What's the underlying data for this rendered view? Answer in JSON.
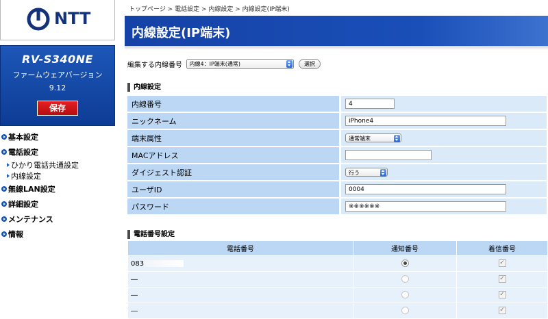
{
  "logo": {
    "brand": "NTT"
  },
  "model": {
    "name": "RV-S340NE",
    "firmware_label": "ファームウェアバージョン",
    "firmware_version": "9.12"
  },
  "save_label": "保存",
  "nav": {
    "basic": "基本設定",
    "phone": "電話設定",
    "phone_sub": [
      "ひかり電話共通設定",
      "内線設定"
    ],
    "wlan": "無線LAN設定",
    "detail": "詳細設定",
    "maintenance": "メンテナンス",
    "info": "情報"
  },
  "breadcrumb": "トップページ > 電話設定 > 内線設定 > 内線設定(IP端末)",
  "page_title": "内線設定(IP端末)",
  "edit": {
    "label": "編集する内線番号",
    "selected": "内線4：IP端末(通常)",
    "button": "選択"
  },
  "ext_section": "内線設定",
  "ext_rows": [
    {
      "label": "内線番号",
      "value": "4"
    },
    {
      "label": "ニックネーム",
      "value": "iPhone4"
    },
    {
      "label": "端末属性",
      "value": "通常端末"
    },
    {
      "label": "MACアドレス",
      "value": ""
    },
    {
      "label": "ダイジェスト認証",
      "value": "行う"
    },
    {
      "label": "ユーザID",
      "value": "0004"
    },
    {
      "label": "パスワード",
      "value": "※※※※※※"
    }
  ],
  "phone_section": "電話番号設定",
  "phone_headers": [
    "電話番号",
    "通知番号",
    "着信番号"
  ],
  "phone_rows": [
    {
      "number": "083",
      "notify": true,
      "incoming": true
    },
    {
      "number": "―",
      "notify": false,
      "incoming": true
    },
    {
      "number": "―",
      "notify": false,
      "incoming": true
    },
    {
      "number": "―",
      "notify": false,
      "incoming": true
    }
  ],
  "colors": {
    "brand_blue": "#1542a6",
    "save_red": "#d41a1c",
    "label_bg": "#bcd7f4",
    "value_bg": "#dbeaf9"
  }
}
